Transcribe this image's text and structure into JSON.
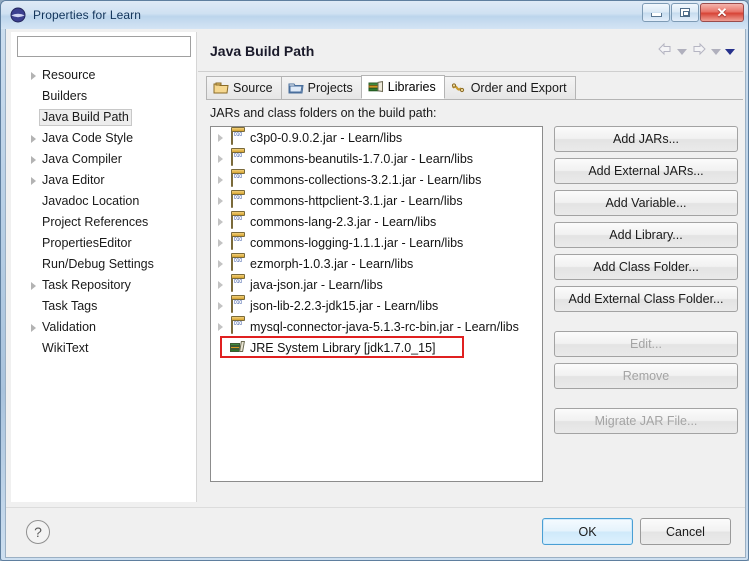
{
  "window": {
    "title": "Properties for Learn",
    "icon": "eclipse-globe-icon",
    "controls": {
      "minimize": "minimize-button",
      "restore": "restore-button",
      "close_label": "✕"
    }
  },
  "sidebar": {
    "filter_value": "",
    "filter_placeholder": "",
    "items": [
      {
        "label": "Resource",
        "expandable": true,
        "selected": false
      },
      {
        "label": "Builders",
        "expandable": false,
        "selected": false
      },
      {
        "label": "Java Build Path",
        "expandable": false,
        "selected": true
      },
      {
        "label": "Java Code Style",
        "expandable": true,
        "selected": false
      },
      {
        "label": "Java Compiler",
        "expandable": true,
        "selected": false
      },
      {
        "label": "Java Editor",
        "expandable": true,
        "selected": false
      },
      {
        "label": "Javadoc Location",
        "expandable": false,
        "selected": false
      },
      {
        "label": "Project References",
        "expandable": false,
        "selected": false
      },
      {
        "label": "PropertiesEditor",
        "expandable": false,
        "selected": false
      },
      {
        "label": "Run/Debug Settings",
        "expandable": false,
        "selected": false
      },
      {
        "label": "Task Repository",
        "expandable": true,
        "selected": false
      },
      {
        "label": "Task Tags",
        "expandable": false,
        "selected": false
      },
      {
        "label": "Validation",
        "expandable": true,
        "selected": false
      },
      {
        "label": "WikiText",
        "expandable": false,
        "selected": false
      }
    ]
  },
  "page": {
    "title": "Java Build Path",
    "nav": {
      "back_icon": "arrow-left-icon",
      "back_menu_icon": "chevron-down-icon",
      "forward_icon": "arrow-right-icon",
      "forward_menu_icon": "chevron-down-icon",
      "menu_icon": "chevron-down-icon"
    }
  },
  "tabs": [
    {
      "label": "Source",
      "icon": "source-folder-icon",
      "active": false
    },
    {
      "label": "Projects",
      "icon": "projects-folder-icon",
      "active": false
    },
    {
      "label": "Libraries",
      "icon": "libraries-books-icon",
      "active": true
    },
    {
      "label": "Order and Export",
      "icon": "order-export-links-icon",
      "active": false
    }
  ],
  "libraries": {
    "caption": "JARs and class folders on the build path:",
    "entries": [
      {
        "label": "c3p0-0.9.0.2.jar - Learn/libs",
        "icon": "jar-icon",
        "expandable": true,
        "highlighted": false
      },
      {
        "label": "commons-beanutils-1.7.0.jar - Learn/libs",
        "icon": "jar-icon",
        "expandable": true,
        "highlighted": false
      },
      {
        "label": "commons-collections-3.2.1.jar - Learn/libs",
        "icon": "jar-icon",
        "expandable": true,
        "highlighted": false
      },
      {
        "label": "commons-httpclient-3.1.jar - Learn/libs",
        "icon": "jar-icon",
        "expandable": true,
        "highlighted": false
      },
      {
        "label": "commons-lang-2.3.jar - Learn/libs",
        "icon": "jar-icon",
        "expandable": true,
        "highlighted": false
      },
      {
        "label": "commons-logging-1.1.1.jar - Learn/libs",
        "icon": "jar-icon",
        "expandable": true,
        "highlighted": false
      },
      {
        "label": "ezmorph-1.0.3.jar - Learn/libs",
        "icon": "jar-icon",
        "expandable": true,
        "highlighted": false
      },
      {
        "label": "java-json.jar - Learn/libs",
        "icon": "jar-icon",
        "expandable": true,
        "highlighted": false
      },
      {
        "label": "json-lib-2.2.3-jdk15.jar - Learn/libs",
        "icon": "jar-icon",
        "expandable": true,
        "highlighted": false
      },
      {
        "label": "mysql-connector-java-5.1.3-rc-bin.jar - Learn/libs",
        "icon": "jar-icon",
        "expandable": true,
        "highlighted": false
      },
      {
        "label": "JRE System Library [jdk1.7.0_15]",
        "icon": "library-books-icon",
        "expandable": false,
        "highlighted": true
      }
    ],
    "buttons": [
      {
        "label": "Add JARs...",
        "enabled": true
      },
      {
        "label": "Add External JARs...",
        "enabled": true
      },
      {
        "label": "Add Variable...",
        "enabled": true
      },
      {
        "label": "Add Library...",
        "enabled": true
      },
      {
        "label": "Add Class Folder...",
        "enabled": true
      },
      {
        "label": "Add External Class Folder...",
        "enabled": true
      },
      {
        "label": "Edit...",
        "enabled": false
      },
      {
        "label": "Remove",
        "enabled": false
      },
      {
        "label": "Migrate JAR File...",
        "enabled": false
      }
    ]
  },
  "footer": {
    "help_icon": "help-question-icon",
    "help_label": "?",
    "ok_label": "OK",
    "cancel_label": "Cancel"
  },
  "colors": {
    "accent": "#4a9fd4",
    "highlight": "#e02020",
    "titlebar": "#cfe1f2",
    "close": "#d74437"
  }
}
